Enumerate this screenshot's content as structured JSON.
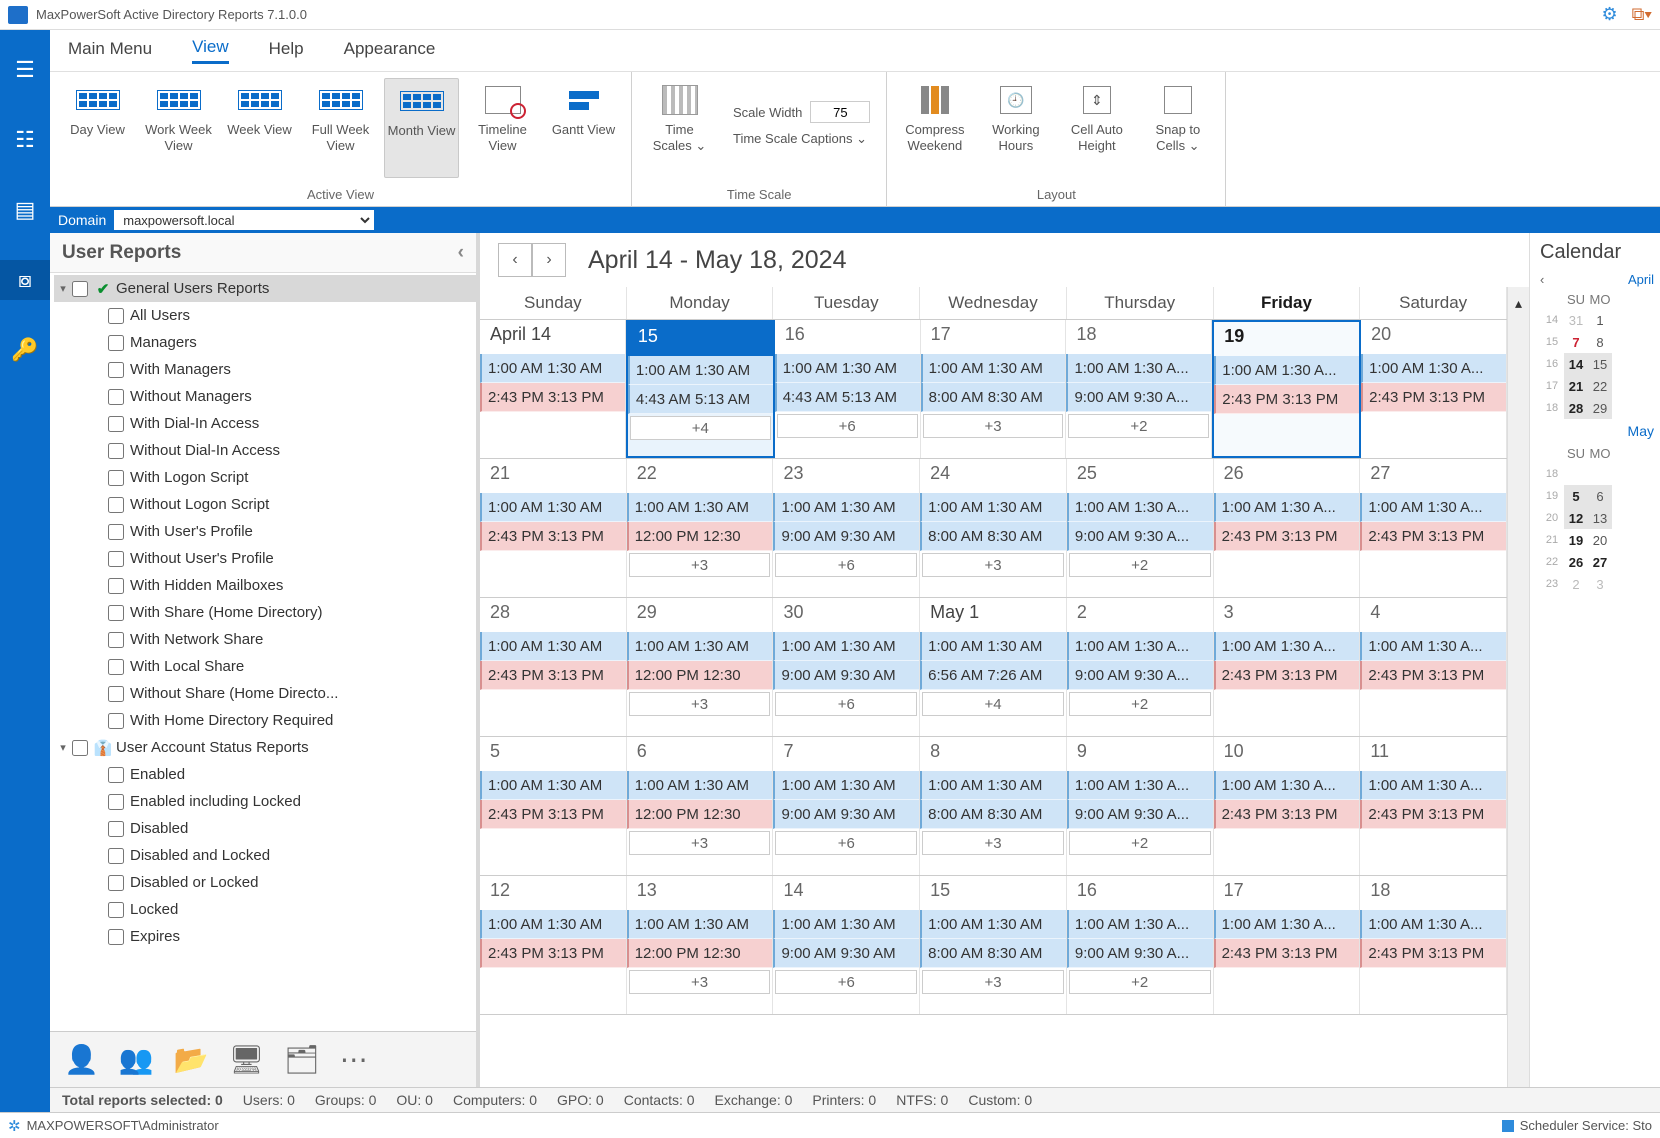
{
  "app": {
    "title": "MaxPowerSoft Active Directory Reports 7.1.0.0"
  },
  "menu": {
    "main": "Main Menu",
    "view": "View",
    "help": "Help",
    "appearance": "Appearance"
  },
  "ribbon": {
    "group1_label": "Active View",
    "btns1": [
      {
        "label": "Day View"
      },
      {
        "label": "Work Week View"
      },
      {
        "label": "Week View"
      },
      {
        "label": "Full Week View"
      },
      {
        "label": "Month View",
        "selected": true
      },
      {
        "label": "Timeline View"
      },
      {
        "label": "Gantt View"
      }
    ],
    "group2_label": "Time Scale",
    "time_scales": "Time Scales ⌄",
    "scale_width_label": "Scale Width",
    "scale_width_value": "75",
    "time_scale_captions": "Time Scale Captions ⌄",
    "group3_label": "Layout",
    "btns3": [
      {
        "label": "Compress Weekend"
      },
      {
        "label": "Working Hours"
      },
      {
        "label": "Cell Auto Height"
      },
      {
        "label": "Snap to Cells ⌄"
      }
    ]
  },
  "domain": {
    "label": "Domain",
    "value": "maxpowersoft.local"
  },
  "reports_panel": {
    "title": "User Reports",
    "groups": [
      {
        "name": "General Users Reports",
        "open": true,
        "icon": "check",
        "selected": true,
        "items": [
          "All Users",
          "Managers",
          "With Managers",
          "Without Managers",
          "With Dial-In Access",
          "Without Dial-In Access",
          "With Logon Script",
          "Without Logon Script",
          "With User's Profile",
          "Without User's Profile",
          "With Hidden Mailboxes",
          "With Share (Home Directory)",
          "With Network Share",
          "With Local Share",
          "Without Share (Home Directo...",
          "With Home Directory Required"
        ]
      },
      {
        "name": "User Account Status Reports",
        "open": true,
        "icon": "user-badge",
        "items": [
          "Enabled",
          "Enabled including Locked",
          "Disabled",
          "Disabled and Locked",
          "Disabled or Locked",
          "Locked",
          "Expires"
        ]
      }
    ]
  },
  "calendar": {
    "title": "April 14 - May 18, 2024",
    "days": [
      "Sunday",
      "Monday",
      "Tuesday",
      "Wednesday",
      "Thursday",
      "Friday",
      "Saturday"
    ],
    "today_index": 5,
    "weeks": [
      {
        "dates": [
          "April 14",
          "15",
          "16",
          "17",
          "18",
          "19",
          "20"
        ],
        "selected_index": 1,
        "today_index": 5,
        "events": [
          [
            {
              "c": "blue",
              "t": "1:00 AM 1:30 AM"
            },
            {
              "c": "pink",
              "t": "2:43 PM 3:13 PM"
            }
          ],
          [
            {
              "c": "blue",
              "t": "1:00 AM 1:30 AM"
            },
            {
              "c": "blue",
              "t": "4:43 AM 5:13 AM"
            },
            {
              "more": "+4"
            }
          ],
          [
            {
              "c": "blue",
              "t": "1:00 AM 1:30 AM"
            },
            {
              "c": "blue",
              "t": "4:43 AM 5:13 AM"
            },
            {
              "more": "+6"
            }
          ],
          [
            {
              "c": "blue",
              "t": "1:00 AM 1:30 AM"
            },
            {
              "c": "blue",
              "t": "8:00 AM 8:30 AM"
            },
            {
              "more": "+3"
            }
          ],
          [
            {
              "c": "blue",
              "t": "1:00 AM 1:30 A..."
            },
            {
              "c": "blue",
              "t": "9:00 AM 9:30 A..."
            },
            {
              "more": "+2"
            }
          ],
          [
            {
              "c": "blue",
              "t": "1:00 AM 1:30 A..."
            },
            {
              "c": "pink",
              "t": "2:43 PM 3:13 PM"
            }
          ],
          [
            {
              "c": "blue",
              "t": "1:00 AM 1:30 A..."
            },
            {
              "c": "pink",
              "t": "2:43 PM 3:13 PM"
            }
          ]
        ]
      },
      {
        "dates": [
          "21",
          "22",
          "23",
          "24",
          "25",
          "26",
          "27"
        ],
        "events": [
          [
            {
              "c": "blue",
              "t": "1:00 AM 1:30 AM"
            },
            {
              "c": "pink",
              "t": "2:43 PM 3:13 PM"
            }
          ],
          [
            {
              "c": "blue",
              "t": "1:00 AM 1:30 AM"
            },
            {
              "c": "pink",
              "t": "12:00 PM 12:30"
            },
            {
              "more": "+3"
            }
          ],
          [
            {
              "c": "blue",
              "t": "1:00 AM 1:30 AM"
            },
            {
              "c": "blue",
              "t": "9:00 AM 9:30 AM"
            },
            {
              "more": "+6"
            }
          ],
          [
            {
              "c": "blue",
              "t": "1:00 AM 1:30 AM"
            },
            {
              "c": "blue",
              "t": "8:00 AM 8:30 AM"
            },
            {
              "more": "+3"
            }
          ],
          [
            {
              "c": "blue",
              "t": "1:00 AM 1:30 A..."
            },
            {
              "c": "blue",
              "t": "9:00 AM 9:30 A..."
            },
            {
              "more": "+2"
            }
          ],
          [
            {
              "c": "blue",
              "t": "1:00 AM 1:30 A..."
            },
            {
              "c": "pink",
              "t": "2:43 PM 3:13 PM"
            }
          ],
          [
            {
              "c": "blue",
              "t": "1:00 AM 1:30 A..."
            },
            {
              "c": "pink",
              "t": "2:43 PM 3:13 PM"
            }
          ]
        ]
      },
      {
        "dates": [
          "28",
          "29",
          "30",
          "May 1",
          "2",
          "3",
          "4"
        ],
        "events": [
          [
            {
              "c": "blue",
              "t": "1:00 AM 1:30 AM"
            },
            {
              "c": "pink",
              "t": "2:43 PM 3:13 PM"
            }
          ],
          [
            {
              "c": "blue",
              "t": "1:00 AM 1:30 AM"
            },
            {
              "c": "pink",
              "t": "12:00 PM 12:30"
            },
            {
              "more": "+3"
            }
          ],
          [
            {
              "c": "blue",
              "t": "1:00 AM 1:30 AM"
            },
            {
              "c": "blue",
              "t": "9:00 AM 9:30 AM"
            },
            {
              "more": "+6"
            }
          ],
          [
            {
              "c": "blue",
              "t": "1:00 AM 1:30 AM"
            },
            {
              "c": "blue",
              "t": "6:56 AM 7:26 AM"
            },
            {
              "more": "+4"
            }
          ],
          [
            {
              "c": "blue",
              "t": "1:00 AM 1:30 A..."
            },
            {
              "c": "blue",
              "t": "9:00 AM 9:30 A..."
            },
            {
              "more": "+2"
            }
          ],
          [
            {
              "c": "blue",
              "t": "1:00 AM 1:30 A..."
            },
            {
              "c": "pink",
              "t": "2:43 PM 3:13 PM"
            }
          ],
          [
            {
              "c": "blue",
              "t": "1:00 AM 1:30 A..."
            },
            {
              "c": "pink",
              "t": "2:43 PM 3:13 PM"
            }
          ]
        ]
      },
      {
        "dates": [
          "5",
          "6",
          "7",
          "8",
          "9",
          "10",
          "11"
        ],
        "events": [
          [
            {
              "c": "blue",
              "t": "1:00 AM 1:30 AM"
            },
            {
              "c": "pink",
              "t": "2:43 PM 3:13 PM"
            }
          ],
          [
            {
              "c": "blue",
              "t": "1:00 AM 1:30 AM"
            },
            {
              "c": "pink",
              "t": "12:00 PM 12:30"
            },
            {
              "more": "+3"
            }
          ],
          [
            {
              "c": "blue",
              "t": "1:00 AM 1:30 AM"
            },
            {
              "c": "blue",
              "t": "9:00 AM 9:30 AM"
            },
            {
              "more": "+6"
            }
          ],
          [
            {
              "c": "blue",
              "t": "1:00 AM 1:30 AM"
            },
            {
              "c": "blue",
              "t": "8:00 AM 8:30 AM"
            },
            {
              "more": "+3"
            }
          ],
          [
            {
              "c": "blue",
              "t": "1:00 AM 1:30 A..."
            },
            {
              "c": "blue",
              "t": "9:00 AM 9:30 A..."
            },
            {
              "more": "+2"
            }
          ],
          [
            {
              "c": "blue",
              "t": "1:00 AM 1:30 A..."
            },
            {
              "c": "pink",
              "t": "2:43 PM 3:13 PM"
            }
          ],
          [
            {
              "c": "blue",
              "t": "1:00 AM 1:30 A..."
            },
            {
              "c": "pink",
              "t": "2:43 PM 3:13 PM"
            }
          ]
        ]
      },
      {
        "dates": [
          "12",
          "13",
          "14",
          "15",
          "16",
          "17",
          "18"
        ],
        "events": [
          [
            {
              "c": "blue",
              "t": "1:00 AM 1:30 AM"
            },
            {
              "c": "pink",
              "t": "2:43 PM 3:13 PM"
            }
          ],
          [
            {
              "c": "blue",
              "t": "1:00 AM 1:30 AM"
            },
            {
              "c": "pink",
              "t": "12:00 PM 12:30"
            },
            {
              "more": "+3"
            }
          ],
          [
            {
              "c": "blue",
              "t": "1:00 AM 1:30 AM"
            },
            {
              "c": "blue",
              "t": "9:00 AM 9:30 AM"
            },
            {
              "more": "+6"
            }
          ],
          [
            {
              "c": "blue",
              "t": "1:00 AM 1:30 AM"
            },
            {
              "c": "blue",
              "t": "8:00 AM 8:30 AM"
            },
            {
              "more": "+3"
            }
          ],
          [
            {
              "c": "blue",
              "t": "1:00 AM 1:30 A..."
            },
            {
              "c": "blue",
              "t": "9:00 AM 9:30 A..."
            },
            {
              "more": "+2"
            }
          ],
          [
            {
              "c": "blue",
              "t": "1:00 AM 1:30 A..."
            },
            {
              "c": "pink",
              "t": "2:43 PM 3:13 PM"
            }
          ],
          [
            {
              "c": "blue",
              "t": "1:00 AM 1:30 A..."
            },
            {
              "c": "pink",
              "t": "2:43 PM 3:13 PM"
            }
          ]
        ]
      }
    ]
  },
  "mini_cal": {
    "title": "Calendar",
    "months": [
      {
        "name": "April",
        "head": [
          "SU",
          "MO"
        ],
        "rows": [
          {
            "wk": "14",
            "d": [
              {
                "v": "31",
                "cls": "dim"
              },
              {
                "v": "1"
              }
            ]
          },
          {
            "wk": "15",
            "d": [
              {
                "v": "7",
                "cls": "red"
              },
              {
                "v": "8"
              }
            ]
          },
          {
            "wk": "16",
            "d": [
              {
                "v": "14",
                "cls": "hl bold"
              },
              {
                "v": "15",
                "cls": "hl"
              }
            ]
          },
          {
            "wk": "17",
            "d": [
              {
                "v": "21",
                "cls": "hl bold"
              },
              {
                "v": "22",
                "cls": "hl"
              }
            ]
          },
          {
            "wk": "18",
            "d": [
              {
                "v": "28",
                "cls": "hl bold"
              },
              {
                "v": "29",
                "cls": "hl"
              }
            ]
          }
        ]
      },
      {
        "name": "May",
        "head": [
          "SU",
          "MO"
        ],
        "rows": [
          {
            "wk": "18",
            "d": [
              {
                "v": "",
                "cls": ""
              },
              {
                "v": ""
              }
            ]
          },
          {
            "wk": "19",
            "d": [
              {
                "v": "5",
                "cls": "hl bold"
              },
              {
                "v": "6",
                "cls": "hl"
              }
            ]
          },
          {
            "wk": "20",
            "d": [
              {
                "v": "12",
                "cls": "hl bold"
              },
              {
                "v": "13",
                "cls": "hl"
              }
            ]
          },
          {
            "wk": "21",
            "d": [
              {
                "v": "19",
                "cls": "red bold"
              },
              {
                "v": "20"
              }
            ]
          },
          {
            "wk": "22",
            "d": [
              {
                "v": "26",
                "cls": "red bold"
              },
              {
                "v": "27",
                "cls": "bold"
              }
            ]
          },
          {
            "wk": "23",
            "d": [
              {
                "v": "2",
                "cls": "dim"
              },
              {
                "v": "3",
                "cls": "dim"
              }
            ]
          }
        ]
      }
    ]
  },
  "stats": {
    "total_label": "Total reports selected: 0",
    "items": [
      "Users: 0",
      "Groups: 0",
      "OU: 0",
      "Computers: 0",
      "GPO: 0",
      "Contacts: 0",
      "Exchange: 0",
      "Printers: 0",
      "NTFS: 0",
      "Custom: 0"
    ]
  },
  "status": {
    "user": "MAXPOWERSOFT\\Administrator",
    "service": "Scheduler Service: Sto"
  }
}
